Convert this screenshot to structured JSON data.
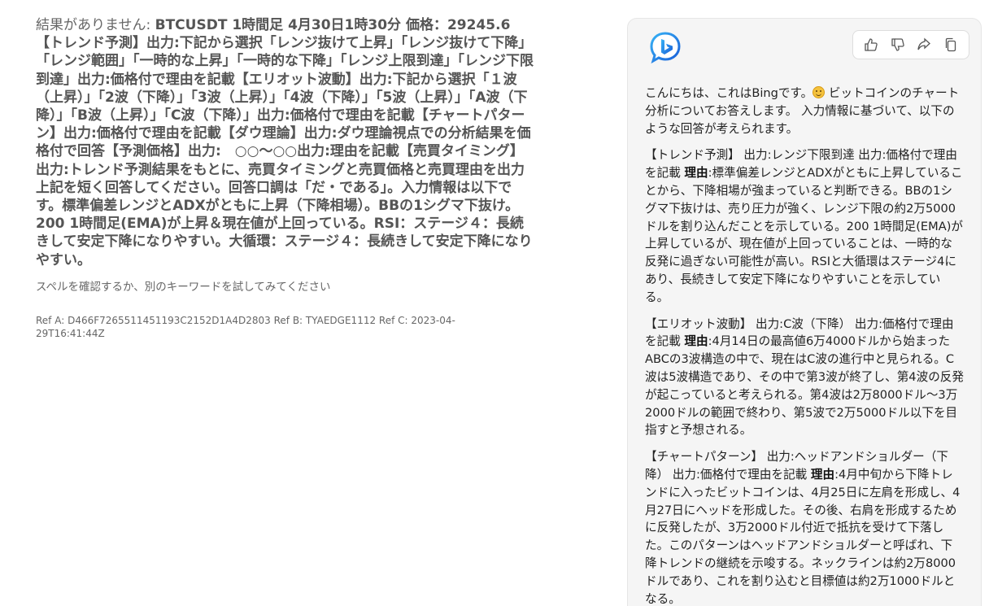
{
  "search": {
    "no_results_prefix": "結果がありません: ",
    "query": "BTCUSDT 1時間足 4月30日1時30分 価格：29245.6【トレンド予測】出力:下記から選択「レンジ抜けて上昇」「レンジ抜けて下降」「レンジ範囲」「一時的な上昇」「一時的な下降」「レンジ上限到達」「レンジ下限到達」出力:価格付で理由を記載【エリオット波動】出力:下記から選択「１波（上昇）」「2波（下降）」「3波（上昇）」「4波（下降）」「5波（上昇）」「A波（下降）」「B波（上昇）」「C波（下降）」出力:価格付で理由を記載【チャートパターン】出力:価格付で理由を記載【ダウ理論】出力:ダウ理論視点での分析結果を価格付で回答【予測価格】出力:　○○～○○出力:理由を記載【売買タイミング】出力:トレンド予測結果をもとに、売買タイミングと売買価格と売買理由を出力上記を短く回答してください。回答口調は「だ・である」。入力情報は以下です。標準偏差レンジとADXがともに上昇（下降相場）。BBの1シグマ下抜け。200 1時間足(EMA)が上昇＆現在値が上回っている。RSI：ステージ４：長続きして安定下降になりやすい。大循環：ステージ４：長続きして安定下降になりやすい。",
    "hint": "スペルを確認するか、別のキーワードを試してみてください",
    "ref": "Ref A: D466F7265511451193C2152D1A4D2803 Ref B: TYAEDGE1112 Ref C: 2023-04-29T16:41:44Z"
  },
  "chat": {
    "logo_icon": "bing-logo",
    "actions": [
      {
        "name": "thumbs-up-icon"
      },
      {
        "name": "thumbs-down-icon"
      },
      {
        "name": "share-icon"
      },
      {
        "name": "copy-icon"
      }
    ],
    "intro_before_emoji": "こんにちは、これはBingです。",
    "intro_after_emoji": " ビットコインのチャート分析についてお答えします。 入力情報に基づいて、以下のような回答が考えられます。",
    "sections": [
      {
        "heading": "【トレンド予測】 出力:レンジ下限到達 出力:価格付で理由を記載 ",
        "reason_label": "理由",
        "body": ":標準偏差レンジとADXがともに上昇していることから、下降相場が強まっていると判断できる。BBの1シグマ下抜けは、売り圧力が強く、レンジ下限の約2万5000ドルを割り込んだことを示している。200 1時間足(EMA)が上昇しているが、現在値が上回っていることは、一時的な反発に過ぎない可能性が高い。RSIと大循環はステージ4にあり、長続きして安定下降になりやすいことを示している。"
      },
      {
        "heading": "【エリオット波動】 出力:C波（下降） 出力:価格付で理由を記載 ",
        "reason_label": "理由",
        "body": ":4月14日の最高値6万4000ドルから始まったABCの3波構造の中で、現在はC波の進行中と見られる。C波は5波構造であり、その中で第3波が終了し、第4波の反発が起こっていると考えられる。第4波は2万8000ドル～3万2000ドルの範囲で終わり、第5波で2万5000ドル以下を目指すと予想される。"
      },
      {
        "heading": "【チャートパターン】 出力:ヘッドアンドショルダー（下降） 出力:価格付で理由を記載 ",
        "reason_label": "理由",
        "body": ":4月中旬から下降トレンドに入ったビットコインは、4月25日に左肩を形成し、4月27日にヘッドを形成した。その後、右肩を形成するために反発したが、3万2000ドル付近で抵抗を受けて下落した。このパターンはヘッドアンドショルダーと呼ばれ、下降トレンドの継続を示唆する。ネックラインは約2万8000ドルであり、これを割り込むと目標値は約2万1000ドルとなる。"
      }
    ]
  }
}
